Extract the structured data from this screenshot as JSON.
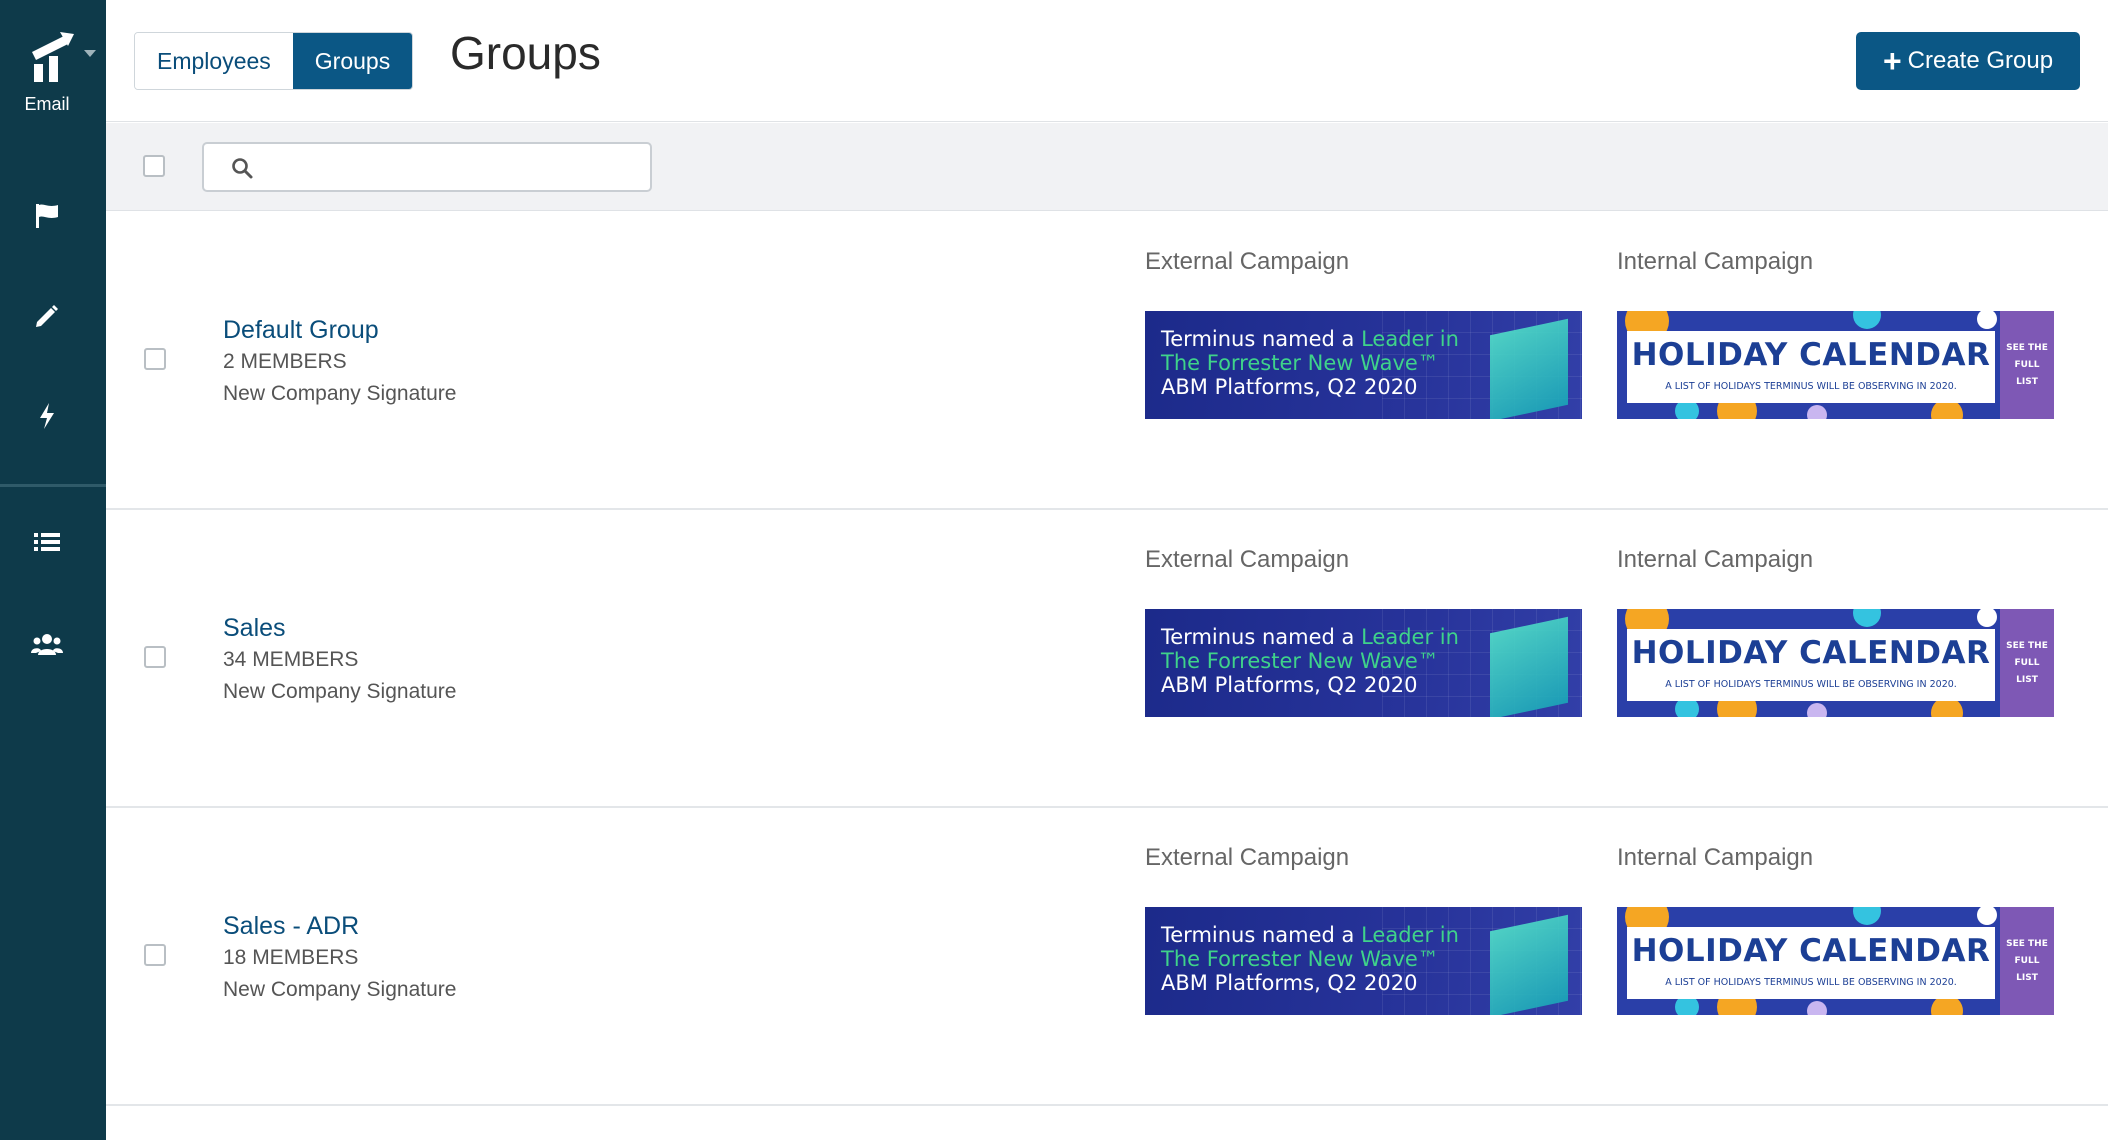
{
  "sidebar": {
    "app_label": "Email",
    "items": [
      {
        "icon": "flag-icon"
      },
      {
        "icon": "pencil-icon"
      },
      {
        "icon": "bolt-icon"
      },
      {
        "icon": "list-icon"
      },
      {
        "icon": "users-icon"
      }
    ]
  },
  "header": {
    "tabs": [
      {
        "label": "Employees",
        "active": false
      },
      {
        "label": "Groups",
        "active": true
      }
    ],
    "title": "Groups",
    "create_label": "Create Group"
  },
  "toolbar": {
    "search_placeholder": ""
  },
  "groups": [
    {
      "name": "Default Group",
      "members": "2 MEMBERS",
      "signature": "New Company Signature",
      "external_label": "External Campaign",
      "internal_label": "Internal Campaign"
    },
    {
      "name": "Sales",
      "members": "34 MEMBERS",
      "signature": "New Company Signature",
      "external_label": "External Campaign",
      "internal_label": "Internal Campaign"
    },
    {
      "name": "Sales - ADR",
      "members": "18 MEMBERS",
      "signature": "New Company Signature",
      "external_label": "External Campaign",
      "internal_label": "Internal Campaign"
    }
  ],
  "banners": {
    "external": {
      "line1_prefix": "Terminus named a ",
      "line1_highlight": "Leader in",
      "line2": "The Forrester New Wave™",
      "line3": "ABM Platforms, Q2 2020"
    },
    "internal": {
      "title": "HOLIDAY CALENDAR",
      "subtitle": "A LIST OF HOLIDAYS TERMINUS WILL BE OBSERVING IN 2020.",
      "side_line1": "SEE THE",
      "side_line2": "FULL",
      "side_line3": "LIST"
    }
  },
  "colors": {
    "sidebar_bg": "#0e3a4a",
    "primary": "#0b5785",
    "link": "#0a4d7a"
  }
}
